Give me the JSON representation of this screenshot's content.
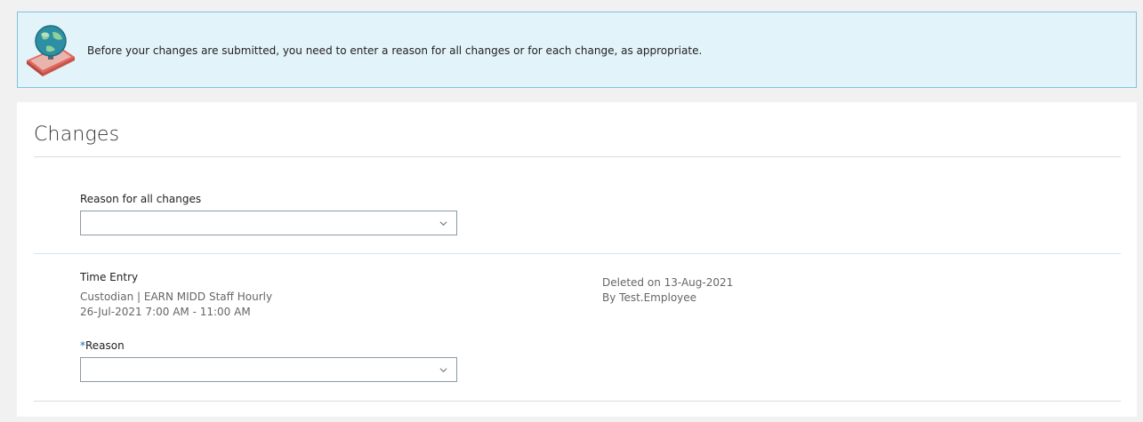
{
  "banner": {
    "message": "Before your changes are submitted, you need to enter a reason for all changes or for each change, as appropriate.",
    "icon": "book-globe-icon"
  },
  "changes": {
    "title": "Changes",
    "reason_all": {
      "label": "Reason for all changes",
      "value": ""
    },
    "entry": {
      "title": "Time Entry",
      "detail_line1": "Custodian | EARN MIDD Staff Hourly",
      "detail_line2": "26-Jul-2021 7:00 AM - 11:00 AM",
      "status_line1": "Deleted on 13-Aug-2021",
      "status_line2": "By Test.Employee",
      "reason": {
        "required_mark": "*",
        "label": "Reason",
        "value": ""
      }
    }
  },
  "colors": {
    "banner_bg": "#e3f3fa",
    "banner_border": "#7fc3df",
    "accent": "#0a72b8"
  }
}
